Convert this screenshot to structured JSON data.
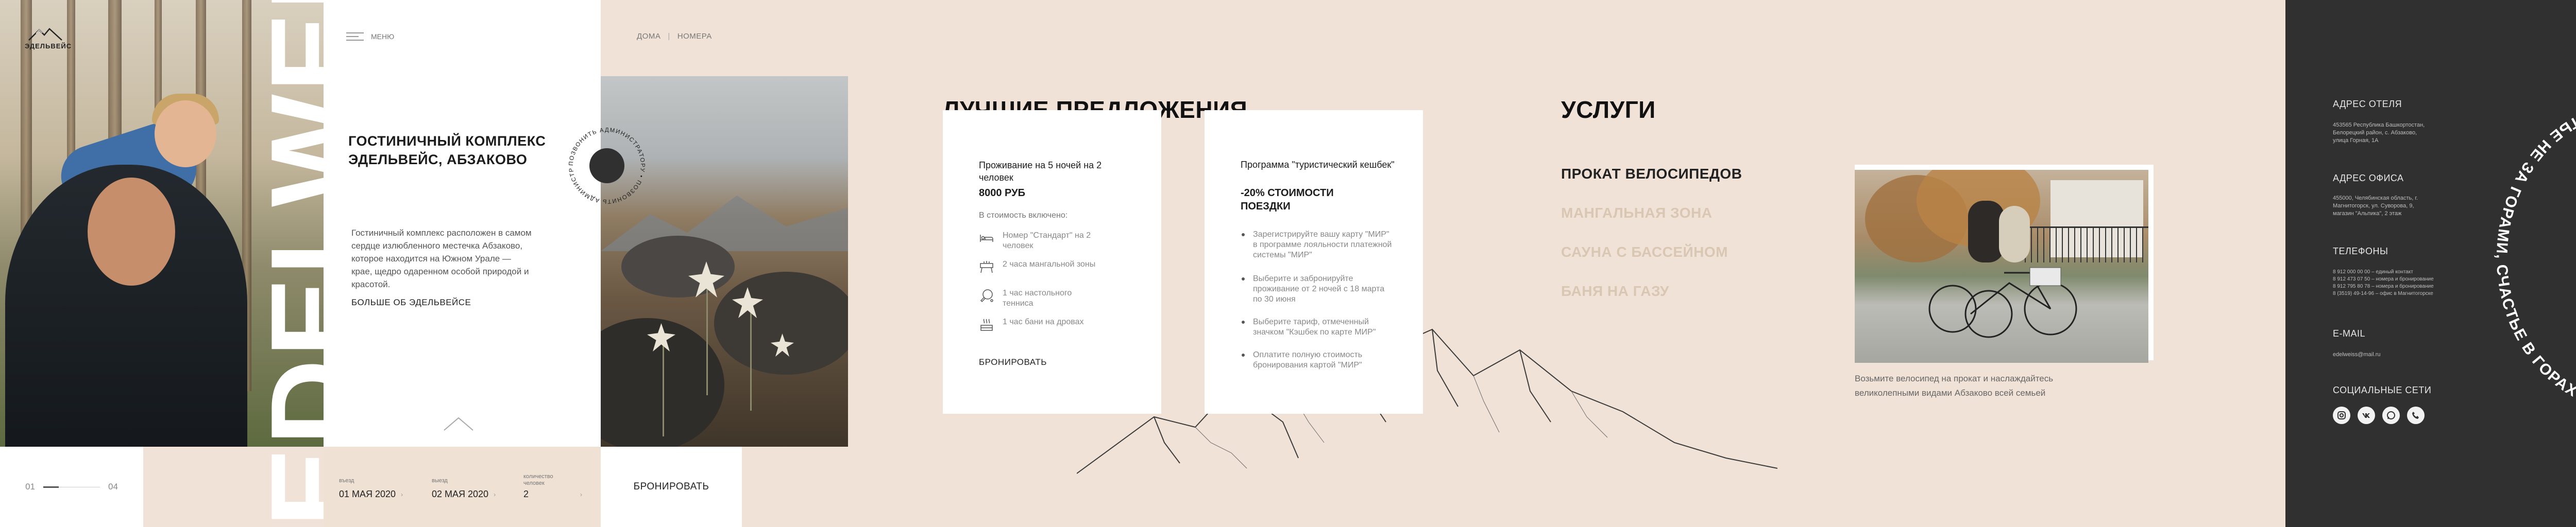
{
  "logo": {
    "text": "ЭДЕЛЬВЕЙС"
  },
  "menu": {
    "label": "МЕНЮ"
  },
  "hero": {
    "big_word": "EDELWEISS",
    "title": "ГОСТИНИЧНЫЙ КОМПЛЕКС ЭДЕЛЬВЕЙС, АБЗАКОВО",
    "description": "Гостиничный комплекс расположен в самом сердце излюбленного местечка Абзаково, которое находится на Южном Урале — крае, щедро одаренном особой природой и красотой.",
    "more_link": "БОЛЬШЕ ОБ ЭДЕЛЬВЕЙСЕ"
  },
  "pager": {
    "current": "01",
    "total": "04",
    "progress": 0.25
  },
  "booking": {
    "checkin_label": "въезд",
    "checkin_value": "01 МАЯ 2020",
    "checkout_label": "выезд",
    "checkout_value": "02 МАЯ 2020",
    "guests_label": "количество человек",
    "guests_value": "2",
    "button": "БРОНИРОВАТЬ"
  },
  "badge": {
    "text": "ПОЗВОНИТЬ АДМИНИСТРАТОРУ • ПОЗВОНИТЬ АДМИНИСТРАТОРУ •"
  },
  "breadcrumb": {
    "home": "ДОМА",
    "sep": "|",
    "current": "НОМЕРА"
  },
  "offers": {
    "title": "ЛУЧШИЕ ПРЕДЛОЖЕНИЯ",
    "card1": {
      "title": "Проживание на 5 ночей на 2 человек",
      "price": "8000 РУБ",
      "included_label": "В стоимость включено:",
      "features": [
        {
          "icon": "bed-icon",
          "text": "Номер \"Стандарт\" на 2 человек"
        },
        {
          "icon": "grill-icon",
          "text": "2 часа мангальной зоны"
        },
        {
          "icon": "ping-pong-icon",
          "text": "1 час настольного тенниса"
        },
        {
          "icon": "sauna-icon",
          "text": "1 час бани на дровах"
        }
      ],
      "link": "БРОНИРОВАТЬ"
    },
    "card2": {
      "title": "Программа \"туристический кешбек\"",
      "subtitle": "-20% СТОИМОСТИ ПОЕЗДКИ",
      "steps": [
        "Зарегистрируйте вашу карту \"МИР\" в программе лояльности платежной системы \"МИР\"",
        "Выберите и забронируйте проживание от 2 ночей с 18 марта по 30 июня",
        "Выберите тариф, отмеченный значком \"Кэшбек по карте МИР\"",
        "Оплатите полную стоимость бронирования картой \"МИР\""
      ]
    }
  },
  "services": {
    "title": "УСЛУГИ",
    "items": [
      {
        "label": "ПРОКАТ ВЕЛОСИПЕДОВ",
        "active": true
      },
      {
        "label": "МАНГАЛЬНАЯ ЗОНА",
        "active": false
      },
      {
        "label": "САУНА С БАССЕЙНОМ",
        "active": false
      },
      {
        "label": "БАНЯ НА ГАЗУ",
        "active": false
      }
    ],
    "caption": "Возьмите велосипед на прокат и наслаждайтесь великолепными видами Абзаково всей семьей"
  },
  "footer": {
    "hotel_address_title": "АДРЕС ОТЕЛЯ",
    "hotel_address": "453565 Республика Башкортостан, Белорецкий район, с. Абзаково, улица Горная, 1А",
    "office_address_title": "АДРЕС ОФИСА",
    "office_address": "455000, Челябинская область, г. Магнитогорск, ул. Суворова, 9, магазин \"Альпика\", 2 этаж",
    "phones_title": "ТЕЛЕФОНЫ",
    "phones": [
      "8 912 000 00 00 – единый контакт",
      "8 912 473 07 50 – номера и бронирование",
      "8 912 795 80 78 – номера и бронирование",
      "8 (3519) 49-14-96 – офис в Магнитогорске"
    ],
    "email_title": "E-MAIL",
    "email": "edelweiss@mail.ru",
    "social_title": "СОЦИАЛЬНЫЕ СЕТИ",
    "social": [
      "instagram-icon",
      "vk-icon",
      "whatsapp-icon",
      "phone-icon"
    ],
    "slogan": "СЧАСТЬЕ НЕ ЗА ГОРАМИ, СЧАСТЬЕ В ГОРАХ"
  },
  "colors": {
    "beige": "#f0e2d6",
    "dark": "#303030",
    "white": "#ffffff"
  }
}
